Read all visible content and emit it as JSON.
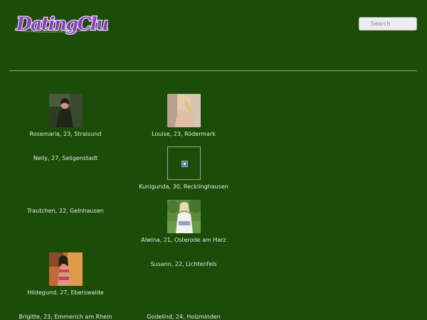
{
  "header": {
    "logo_text": "DatingClub",
    "search_placeholder": "Search"
  },
  "colors": {
    "background": "#1c4d08",
    "logo_fill": "#8a3fc0",
    "logo_outline": "#f2ecf8",
    "text": "#e8e8e8"
  },
  "profiles": [
    {
      "caption": "Rosemaria, 23, Stralsund",
      "photo": "photo"
    },
    {
      "caption": "Louise, 23, Rödermark",
      "photo": "photo"
    },
    {
      "caption": "Nelly, 27, Seligenstadt",
      "photo": "none"
    },
    {
      "caption": "Kunigunda, 30, Recklinghausen",
      "photo": "broken-image"
    },
    {
      "caption": "Trautchen, 22, Gelnhausen",
      "photo": "none"
    },
    {
      "caption": "Alwina, 21, Osterode am Harz",
      "photo": "photo"
    },
    {
      "caption": "Hildegund, 27, Eberswalde",
      "photo": "photo"
    },
    {
      "caption": "Susann, 22, Lichtenfels",
      "photo": "none"
    },
    {
      "caption": "Brigitte, 23, Emmerich am Rhein",
      "photo": "none"
    },
    {
      "caption": "Godelind, 24, Holzminden",
      "photo": "none"
    }
  ]
}
